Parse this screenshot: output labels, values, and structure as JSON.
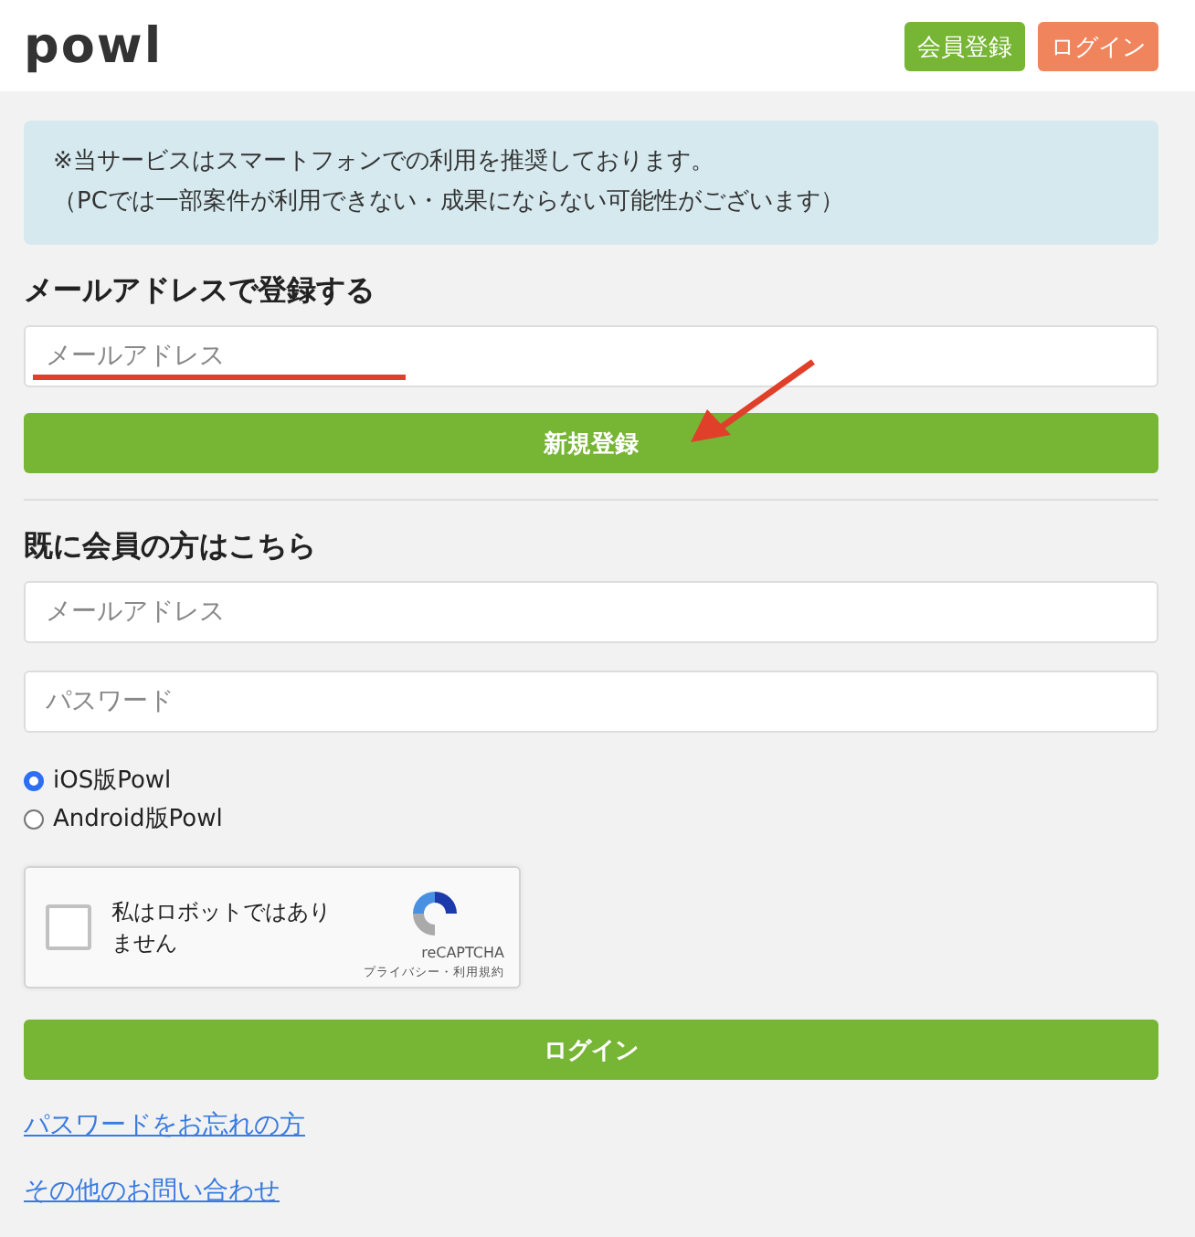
{
  "header": {
    "logo": "powl",
    "buttons": [
      {
        "label": "会員登録",
        "kind": "register"
      },
      {
        "label": "ログイン",
        "kind": "login"
      }
    ]
  },
  "notice": [
    "※当サービスはスマートフォンでの利用を推奨しております。",
    "（PCでは一部案件が利用できない・成果にならない可能性がございます）"
  ],
  "register": {
    "heading": "メールアドレスで登録する",
    "email_placeholder": "メールアドレス",
    "button": "新規登録"
  },
  "login": {
    "heading": "既に会員の方はこちら",
    "email_placeholder": "メールアドレス",
    "password_placeholder": "パスワード",
    "platforms": [
      {
        "label": "iOS版Powl",
        "selected": true
      },
      {
        "label": "Android版Powl",
        "selected": false
      }
    ],
    "captcha": {
      "label": "私はロボットではありません",
      "checked": false,
      "brand": "reCAPTCHA",
      "links": "プライバシー・利用規約"
    },
    "button": "ログイン"
  },
  "links": [
    "パスワードをお忘れの方",
    "その他のお問い合わせ"
  ]
}
